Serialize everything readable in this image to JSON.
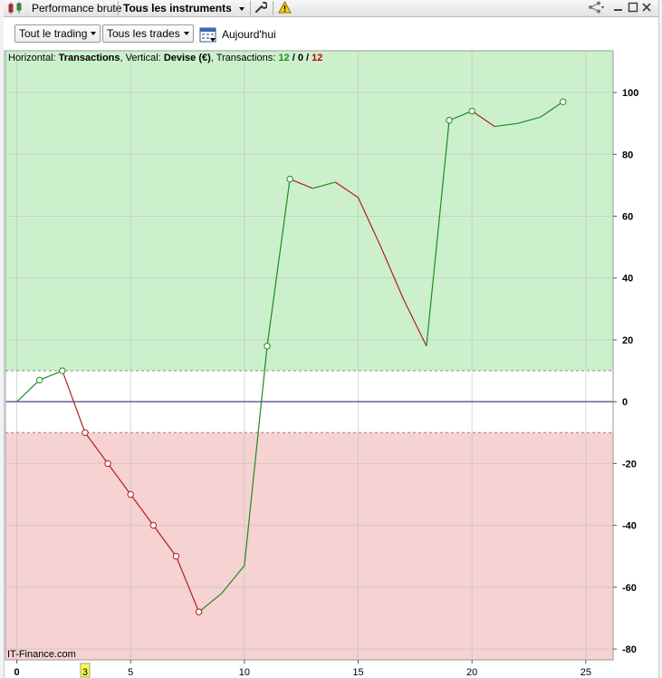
{
  "window": {
    "tab_performance": "Performance brute",
    "tab_instruments": "Tous les instruments"
  },
  "toolbar": {
    "trading_filter": "Tout le trading",
    "trades_filter": "Tous les trades",
    "today_label": "Aujourd'hui"
  },
  "info_bar": {
    "horizontal_prefix": "Horizontal:",
    "horizontal_value": "Transactions",
    "vertical_prefix": ", Vertical:",
    "vertical_value": "Devise (€)",
    "transactions_prefix": ", Transactions:",
    "count_winning": "12",
    "sep1": " / ",
    "count_neutral": "0",
    "sep2": " / ",
    "count_losing": "12"
  },
  "credit": "IT-Finance.com",
  "colors": {
    "gain_zone": "#ccf0cc",
    "loss_zone": "#f6d2d2",
    "gain_line": "#1e8c1e",
    "loss_line": "#b41e1e",
    "zero_line": "#1a1a6e",
    "winning_count": "#1e8c1e",
    "losing_count": "#c80000"
  },
  "chart_data": {
    "type": "line",
    "title": "",
    "xlabel": "",
    "ylabel": "",
    "xlim": [
      -0.5,
      26.2
    ],
    "ylim": [
      -83.5,
      113.5
    ],
    "x_ticks": [
      0,
      5,
      10,
      15,
      20,
      25
    ],
    "y_ticks": [
      -80,
      -60,
      -40,
      -20,
      0,
      20,
      40,
      60,
      80,
      100
    ],
    "highlighted_x_tick": "3",
    "gain_threshold": 10,
    "loss_threshold": -10,
    "grid": true,
    "series": [
      {
        "x": [
          0,
          1,
          2,
          3,
          4,
          5,
          6,
          7,
          8,
          9,
          10,
          11,
          12,
          13,
          14,
          15,
          16,
          17,
          18,
          19,
          20,
          21,
          22,
          23,
          24
        ],
        "y": [
          0,
          7,
          10,
          -10,
          -20,
          -30,
          -40,
          -50,
          -68,
          -62,
          -53,
          18,
          72,
          69,
          71,
          66,
          50,
          33,
          18,
          91,
          94,
          89,
          90,
          92,
          97
        ],
        "markers": [
          1,
          2,
          3,
          4,
          5,
          6,
          7,
          8,
          11,
          12,
          19,
          20,
          24
        ]
      }
    ]
  }
}
